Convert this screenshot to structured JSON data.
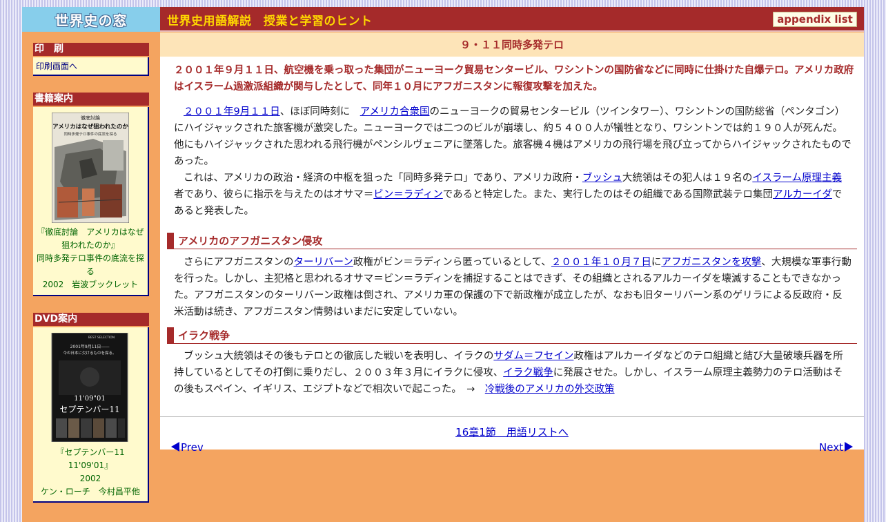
{
  "header": {
    "logo": "世界史の窓",
    "site_title": "世界史用語解説　授業と学習のヒント",
    "appendix_label": "appendix list"
  },
  "sidebar": {
    "print": {
      "heading": "印　刷",
      "link": "印刷画面へ"
    },
    "book": {
      "heading": "書籍案内",
      "cover_title": "徹底討論",
      "cover_main": "アメリカはなぜ狙われたのか",
      "cover_sub": "同時多発テロ事件の底流を探る",
      "caption": [
        "『徹底討論　アメリカはなぜ",
        "狙われたのか』",
        "同時多発テロ事件の底流を探",
        "る",
        "2002　岩波ブックレット"
      ]
    },
    "dvd": {
      "heading": "DVD案内",
      "cover_top": "BEST SELECTION",
      "cover_line": "2001年9月11日――",
      "cover_line2": "今の日本に欠けるものを探る。",
      "cover_num": "11'09\"01",
      "cover_main": "セプテンバー11",
      "caption": [
        "『セプテンバー11",
        "11'09'01』",
        "2002",
        "ケン・ローチ　今村昌平他"
      ]
    }
  },
  "main": {
    "term": "９・１１同時多発テロ",
    "summary": "２００１年９月１１日、航空機を乗っ取った集団がニューヨーク貿易センタービル、ワシントンの国防省などに同時に仕掛けた自爆テロ。アメリカ政府はイスラーム過激派組織が関与したとして、同年１０月にアフガニスタンに報復攻撃を加えた。",
    "p1": [
      "２００１年9月１１日",
      "、ほぼ同時刻に　",
      "アメリカ合衆国",
      "のニューヨークの貿易センタービル（ツインタワー）、ワシントンの国防総省（ペンタゴン）にハイジャックされた旅客機が激突した。ニューヨークでは二つのビルが崩壊し、約５４００人が犠牲となり、ワシントンでは約１９０人が死んだ。他にもハイジャックされた思われる飛行機がペンシルヴェニアに墜落した。旅客機４機はアメリカの飛行場を飛び立ってからハイジャックされたものであった。"
    ],
    "p2": [
      "これは、アメリカの政治・経済の中枢を狙った「同時多発テロ」であり、アメリカ政府・",
      "ブッシュ",
      "大統領はその犯人は１９名の",
      "イスラーム原理主義",
      "者であり、彼らに指示を与えたのはオサマ＝",
      "ビン＝ラディン",
      "であると特定した。また、実行したのはその組織である国際武装テロ集団",
      "アルカーイダ",
      "であると発表した。"
    ],
    "section1": "アメリカのアフガニスタン侵攻",
    "p3": [
      "さらにアフガニスタンの",
      "ターリバーン",
      "政権がビン＝ラディンら匿っているとして、",
      "２００１年１０月７日",
      "に",
      "アフガニスタンを攻撃",
      "、大規模な軍事行動を行った。しかし、主犯格と思われるオサマ＝ビン＝ラディンを捕捉することはできず、その組織とされるアルカーイダを壊滅することもできなかった。アフガニスタンのターリバーン政権は倒され、アメリカ軍の保護の下で新政権が成立したが、なおも旧ターリバーン系のゲリラによる反政府・反米活動は続き、アフガニスタン情勢はいまだに安定していない。"
    ],
    "section2": "イラク戦争",
    "p4": [
      "ブッシュ大統領はその後もテロとの徹底した戦いを表明し、イラクの",
      "サダム＝フセイン",
      "政権はアルカーイダなどのテロ組織と結び大量破壊兵器を所持しているとしてその打倒に乗りだし、２００３年３月にイラクに侵攻、",
      "イラク戦争",
      "に発展させた。しかし、イスラーム原理主義勢力のテロ活動はその後もスペイン、イギリス、エジプトなどで相次いで起こった。　→　",
      "冷戦後のアメリカの外交政策"
    ],
    "chapter_link": "16章1節　用語リストへ",
    "prev": "Prev",
    "next": "Next"
  }
}
